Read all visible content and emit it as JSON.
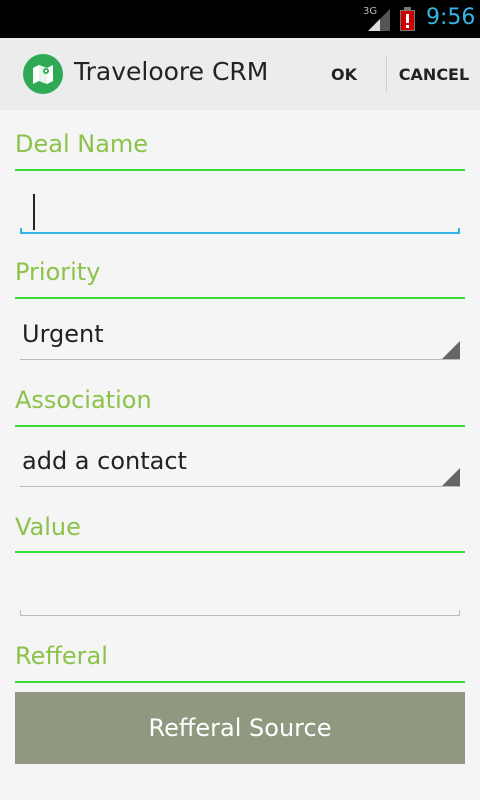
{
  "status_bar": {
    "network": "3G",
    "time": "9:56",
    "time_color": "#33b5e5",
    "icons": [
      "signal-icon",
      "battery-alert-icon"
    ]
  },
  "action_bar": {
    "logo_icon": "map-icon",
    "title": "Traveloore CRM",
    "ok_label": "OK",
    "cancel_label": "CANCEL"
  },
  "form": {
    "deal_name": {
      "label": "Deal Name",
      "value": ""
    },
    "priority": {
      "label": "Priority",
      "selected": "Urgent"
    },
    "association": {
      "label": "Association",
      "selected": "add a contact"
    },
    "value": {
      "label": "Value",
      "value": ""
    },
    "referral": {
      "label": "Refferal",
      "button_label": "Refferal Source"
    }
  },
  "colors": {
    "label": "#8bc34a",
    "section_line": "#33dd33",
    "focus_underline": "#33b5e5",
    "logo_background": "#2eaa55",
    "button_background": "#909880"
  }
}
